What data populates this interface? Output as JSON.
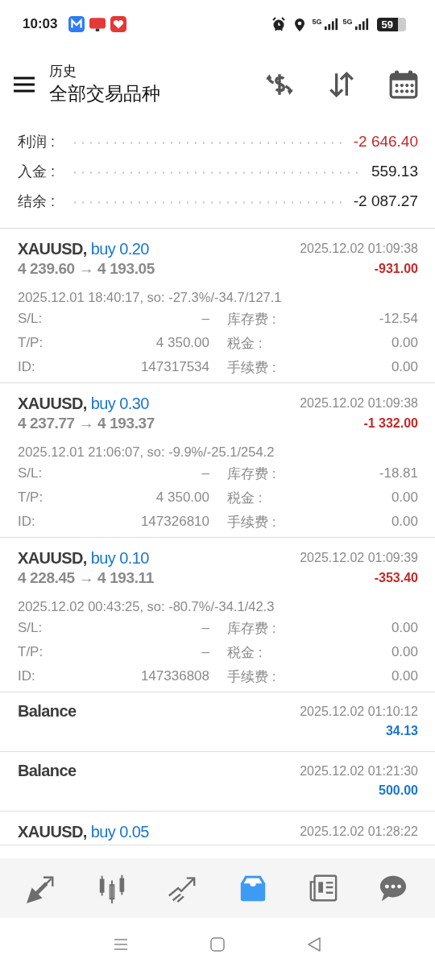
{
  "status_bar": {
    "time": "10:03",
    "network_1": "5G",
    "network_2": "5G",
    "battery": "59"
  },
  "header": {
    "subtitle": "历史",
    "title": "全部交易品种"
  },
  "summary": [
    {
      "label": "利润 :",
      "value": "-2 646.40",
      "color": "#c62828"
    },
    {
      "label": "入金 :",
      "value": "559.13",
      "color": "#212121"
    },
    {
      "label": "结余 :",
      "value": "-2 087.27",
      "color": "#212121"
    }
  ],
  "deals": [
    {
      "kind": "trade",
      "symbol": "XAUUSD,",
      "action": "buy 0.20",
      "time": "2025.12.02 01:09:38",
      "prices": "4 239.60 → 4 193.05",
      "profit": "-931.00",
      "color": "#c62828",
      "detail": "2025.12.01 18:40:17, so: -27.3%/-34.7/127.1",
      "fields": [
        [
          "S/L:",
          "–",
          "库存费 :",
          "-12.54"
        ],
        [
          "T/P:",
          "4 350.00",
          "税金 :",
          "0.00"
        ],
        [
          "ID:",
          "147317534",
          "手续费 :",
          "0.00"
        ]
      ]
    },
    {
      "kind": "trade",
      "symbol": "XAUUSD,",
      "action": "buy 0.30",
      "time": "2025.12.02 01:09:38",
      "prices": "4 237.77 → 4 193.37",
      "profit": "-1 332.00",
      "color": "#c62828",
      "detail": "2025.12.01 21:06:07, so: -9.9%/-25.1/254.2",
      "fields": [
        [
          "S/L:",
          "–",
          "库存费 :",
          "-18.81"
        ],
        [
          "T/P:",
          "4 350.00",
          "税金 :",
          "0.00"
        ],
        [
          "ID:",
          "147326810",
          "手续费 :",
          "0.00"
        ]
      ]
    },
    {
      "kind": "trade",
      "symbol": "XAUUSD,",
      "action": "buy 0.10",
      "time": "2025.12.02 01:09:39",
      "prices": "4 228.45 → 4 193.11",
      "profit": "-353.40",
      "color": "#c62828",
      "detail": "2025.12.02 00:43:25, so: -80.7%/-34.1/42.3",
      "fields": [
        [
          "S/L:",
          "–",
          "库存费 :",
          "0.00"
        ],
        [
          "T/P:",
          "–",
          "税金 :",
          "0.00"
        ],
        [
          "ID:",
          "147336808",
          "手续费 :",
          "0.00"
        ]
      ]
    },
    {
      "kind": "balance",
      "title": "Balance",
      "time": "2025.12.02 01:10:12",
      "amount": "34.13",
      "color": "#1976d2"
    },
    {
      "kind": "balance",
      "title": "Balance",
      "time": "2025.12.02 01:21:30",
      "amount": "500.00",
      "color": "#1976d2"
    },
    {
      "kind": "trade",
      "symbol": "XAUUSD,",
      "action": "buy 0.05",
      "time": "2025.12.02 01:28:22"
    }
  ],
  "nav": [
    {
      "kind": "quotes",
      "selected": false
    },
    {
      "kind": "chart",
      "selected": false
    },
    {
      "kind": "trade",
      "selected": false
    },
    {
      "kind": "history",
      "selected": true
    },
    {
      "kind": "news",
      "selected": false
    },
    {
      "kind": "chat",
      "selected": false
    }
  ]
}
